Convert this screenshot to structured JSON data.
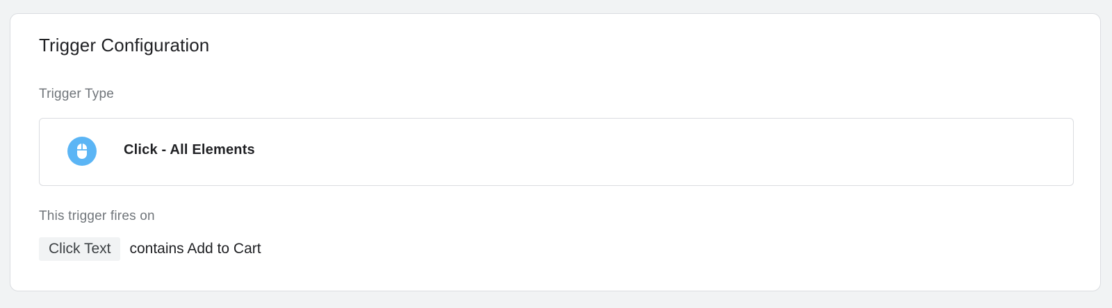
{
  "card": {
    "title": "Trigger Configuration"
  },
  "trigger_type": {
    "label": "Trigger Type",
    "name": "Click - All Elements",
    "icon": "mouse-icon",
    "icon_color": "#5bb5f5"
  },
  "fires_on": {
    "label": "This trigger fires on",
    "variable": "Click Text",
    "condition": "contains Add to Cart"
  }
}
